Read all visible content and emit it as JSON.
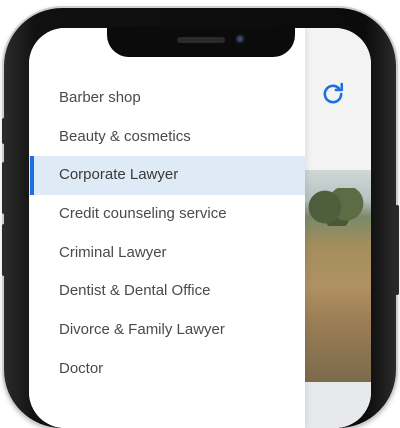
{
  "app": {
    "menu_items": [
      "Barber shop",
      "Beauty & cosmetics",
      "Corporate Lawyer",
      "Credit counseling service",
      "Criminal Lawyer",
      "Dentist & Dental Office",
      "Divorce & Family Lawyer",
      "Doctor",
      ""
    ],
    "selected_index": 2,
    "accent_color": "#1b6fe0",
    "selected_bg_color": "#dfeaf7",
    "icons": {
      "refresh": "refresh-icon"
    }
  }
}
